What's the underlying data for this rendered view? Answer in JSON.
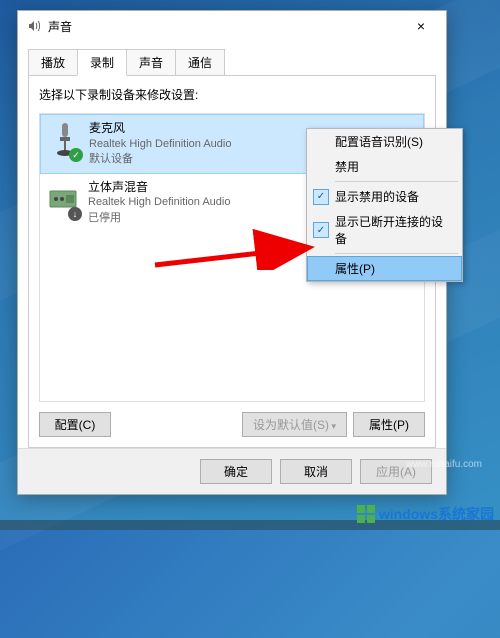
{
  "window": {
    "title": "声音",
    "close_label": "×"
  },
  "tabs": {
    "playback": "播放",
    "recording": "录制",
    "sounds": "声音",
    "communications": "通信"
  },
  "instruction": "选择以下录制设备来修改设置:",
  "devices": [
    {
      "name": "麦克风",
      "driver": "Realtek High Definition Audio",
      "status": "默认设备",
      "selected": true,
      "badge": "check"
    },
    {
      "name": "立体声混音",
      "driver": "Realtek High Definition Audio",
      "status": "已停用",
      "selected": false,
      "badge": "down"
    }
  ],
  "buttons": {
    "configure": "配置(C)",
    "set_default": "设为默认值(S)",
    "properties": "属性(P)",
    "ok": "确定",
    "cancel": "取消",
    "apply": "应用(A)"
  },
  "context_menu": {
    "configure_speech": "配置语音识别(S)",
    "disable": "禁用",
    "show_disabled": "显示禁用的设备",
    "show_disconnected": "显示已断开连接的设备",
    "properties": "属性(P)"
  },
  "watermark": {
    "brand": "windows系统家园",
    "url": "www.ruhaifu.com"
  }
}
